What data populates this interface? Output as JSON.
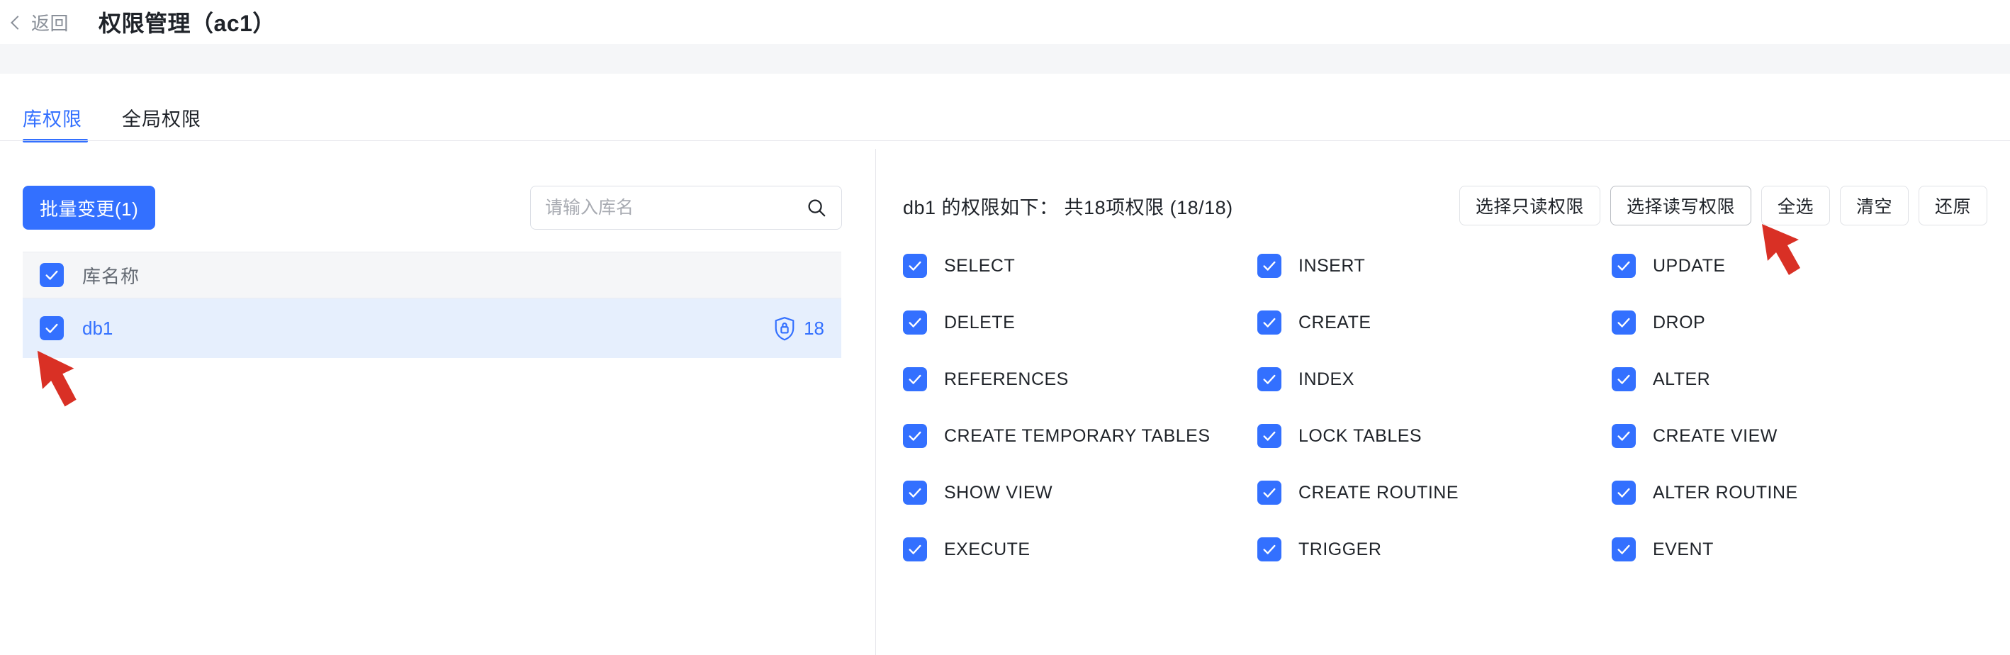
{
  "header": {
    "back_label": "返回",
    "back_icon": "chevron-left-icon",
    "title": "权限管理（ac1）"
  },
  "tabs": [
    {
      "label": "库权限",
      "active": true
    },
    {
      "label": "全局权限",
      "active": false
    }
  ],
  "left_panel": {
    "batch_button_label": "批量变更(1)",
    "search": {
      "placeholder": "请输入库名",
      "value": "",
      "icon": "search-icon"
    },
    "table": {
      "header_checked": true,
      "columns": [
        "库名称"
      ],
      "rows": [
        {
          "name": "db1",
          "checked": true,
          "selected": true,
          "badge_icon": "shield-lock-icon",
          "badge_count": "18"
        }
      ]
    }
  },
  "right_panel": {
    "summary": "db1 的权限如下： 共18项权限 (18/18)",
    "actions": [
      {
        "label": "选择只读权限",
        "hover": false
      },
      {
        "label": "选择读写权限",
        "hover": true
      },
      {
        "label": "全选",
        "hover": false
      },
      {
        "label": "清空",
        "hover": false
      },
      {
        "label": "还原",
        "hover": false
      }
    ],
    "permissions": [
      {
        "label": "SELECT",
        "checked": true
      },
      {
        "label": "INSERT",
        "checked": true
      },
      {
        "label": "UPDATE",
        "checked": true
      },
      {
        "label": "DELETE",
        "checked": true
      },
      {
        "label": "CREATE",
        "checked": true
      },
      {
        "label": "DROP",
        "checked": true
      },
      {
        "label": "REFERENCES",
        "checked": true
      },
      {
        "label": "INDEX",
        "checked": true
      },
      {
        "label": "ALTER",
        "checked": true
      },
      {
        "label": "CREATE TEMPORARY TABLES",
        "checked": true
      },
      {
        "label": "LOCK TABLES",
        "checked": true
      },
      {
        "label": "CREATE VIEW",
        "checked": true
      },
      {
        "label": "SHOW VIEW",
        "checked": true
      },
      {
        "label": "CREATE ROUTINE",
        "checked": true
      },
      {
        "label": "ALTER ROUTINE",
        "checked": true
      },
      {
        "label": "EXECUTE",
        "checked": true
      },
      {
        "label": "TRIGGER",
        "checked": true
      },
      {
        "label": "EVENT",
        "checked": true
      }
    ]
  },
  "annotations": [
    {
      "name": "arrow-pointing-to-db1-checkbox",
      "color": "#d93025"
    },
    {
      "name": "arrow-pointing-to-read-write-button",
      "color": "#d93025"
    }
  ],
  "colors": {
    "accent": "#3370ff",
    "row_selected_bg": "#e6effd",
    "table_header_bg": "#f5f6f8",
    "band_bg": "#f5f6f8",
    "arrow_red": "#d93025",
    "muted_text": "#8a9099"
  }
}
